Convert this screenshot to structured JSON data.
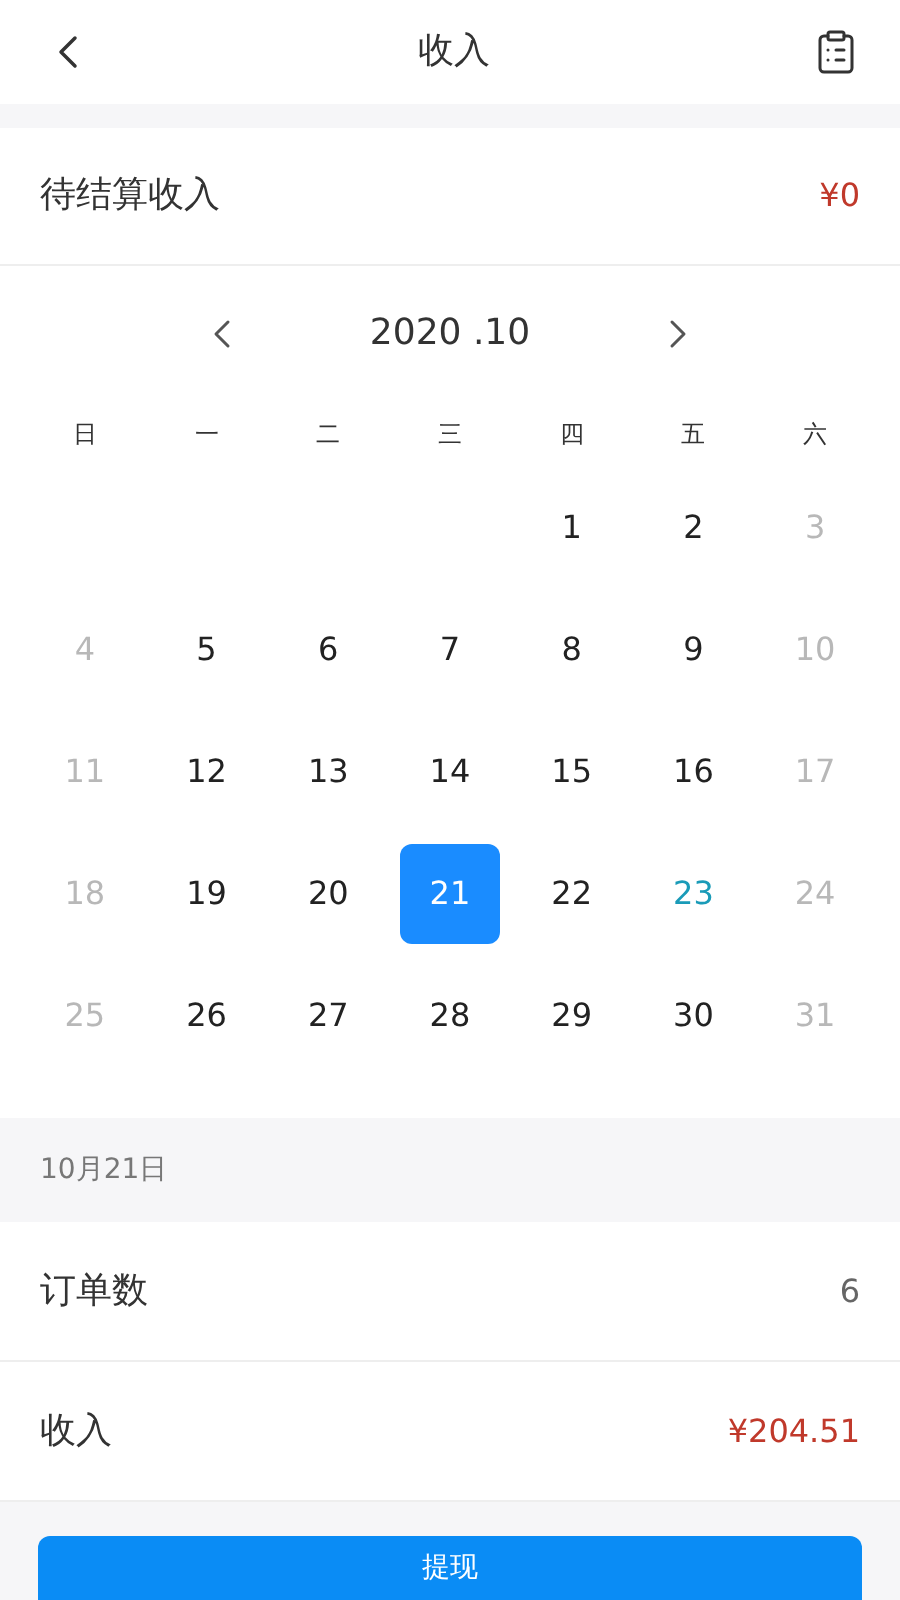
{
  "header": {
    "title": "收入"
  },
  "pending": {
    "label": "待结算收入",
    "value": "¥0"
  },
  "calendar": {
    "month": "2020 .10",
    "weekdays": [
      "日",
      "一",
      "二",
      "三",
      "四",
      "五",
      "六"
    ],
    "days": [
      {
        "kind": "blank"
      },
      {
        "kind": "blank"
      },
      {
        "kind": "blank"
      },
      {
        "kind": "blank"
      },
      {
        "kind": "day",
        "day": "1",
        "muted": false,
        "today": false,
        "selected": false
      },
      {
        "kind": "day",
        "day": "2",
        "muted": false,
        "today": false,
        "selected": false
      },
      {
        "kind": "day",
        "day": "3",
        "muted": true,
        "today": false,
        "selected": false
      },
      {
        "kind": "day",
        "day": "4",
        "muted": true,
        "today": false,
        "selected": false
      },
      {
        "kind": "day",
        "day": "5",
        "muted": false,
        "today": false,
        "selected": false
      },
      {
        "kind": "day",
        "day": "6",
        "muted": false,
        "today": false,
        "selected": false
      },
      {
        "kind": "day",
        "day": "7",
        "muted": false,
        "today": false,
        "selected": false
      },
      {
        "kind": "day",
        "day": "8",
        "muted": false,
        "today": false,
        "selected": false
      },
      {
        "kind": "day",
        "day": "9",
        "muted": false,
        "today": false,
        "selected": false
      },
      {
        "kind": "day",
        "day": "10",
        "muted": true,
        "today": false,
        "selected": false
      },
      {
        "kind": "day",
        "day": "11",
        "muted": true,
        "today": false,
        "selected": false
      },
      {
        "kind": "day",
        "day": "12",
        "muted": false,
        "today": false,
        "selected": false
      },
      {
        "kind": "day",
        "day": "13",
        "muted": false,
        "today": false,
        "selected": false
      },
      {
        "kind": "day",
        "day": "14",
        "muted": false,
        "today": false,
        "selected": false
      },
      {
        "kind": "day",
        "day": "15",
        "muted": false,
        "today": false,
        "selected": false
      },
      {
        "kind": "day",
        "day": "16",
        "muted": false,
        "today": false,
        "selected": false
      },
      {
        "kind": "day",
        "day": "17",
        "muted": true,
        "today": false,
        "selected": false
      },
      {
        "kind": "day",
        "day": "18",
        "muted": true,
        "today": false,
        "selected": false
      },
      {
        "kind": "day",
        "day": "19",
        "muted": false,
        "today": false,
        "selected": false
      },
      {
        "kind": "day",
        "day": "20",
        "muted": false,
        "today": false,
        "selected": false
      },
      {
        "kind": "day",
        "day": "21",
        "muted": false,
        "today": false,
        "selected": true
      },
      {
        "kind": "day",
        "day": "22",
        "muted": false,
        "today": false,
        "selected": false
      },
      {
        "kind": "day",
        "day": "23",
        "muted": false,
        "today": true,
        "selected": false
      },
      {
        "kind": "day",
        "day": "24",
        "muted": true,
        "today": false,
        "selected": false
      },
      {
        "kind": "day",
        "day": "25",
        "muted": true,
        "today": false,
        "selected": false
      },
      {
        "kind": "day",
        "day": "26",
        "muted": false,
        "today": false,
        "selected": false
      },
      {
        "kind": "day",
        "day": "27",
        "muted": false,
        "today": false,
        "selected": false
      },
      {
        "kind": "day",
        "day": "28",
        "muted": false,
        "today": false,
        "selected": false
      },
      {
        "kind": "day",
        "day": "29",
        "muted": false,
        "today": false,
        "selected": false
      },
      {
        "kind": "day",
        "day": "30",
        "muted": false,
        "today": false,
        "selected": false
      },
      {
        "kind": "day",
        "day": "31",
        "muted": true,
        "today": false,
        "selected": false
      }
    ]
  },
  "date_heading": "10月21日",
  "stats": [
    {
      "label": "订单数",
      "value": "6",
      "highlight": false
    },
    {
      "label": "收入",
      "value": "¥204.51",
      "highlight": true
    }
  ],
  "button": "提现"
}
